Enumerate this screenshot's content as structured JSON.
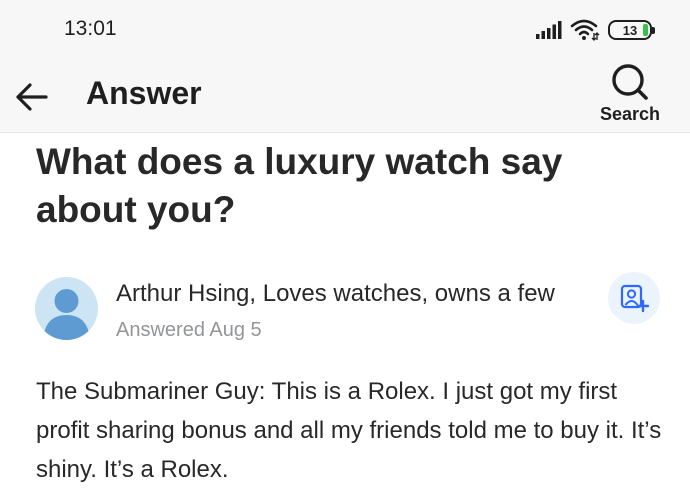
{
  "status_bar": {
    "time": "13:01",
    "battery": "13",
    "icons": [
      "signal-icon",
      "wifi-icon",
      "battery-icon"
    ]
  },
  "app_bar": {
    "title": "Answer",
    "back_icon": "arrow-left-icon",
    "search_label": "Search",
    "search_icon": "search-icon"
  },
  "question": {
    "title": "What does a luxury watch say about you?"
  },
  "answer": {
    "author": "Arthur Hsing, Loves watches, owns a few",
    "date": "Answered Aug 5",
    "follow_icon": "add-person-icon",
    "text": "The Submariner Guy: This is a Rolex. I just got my first profit sharing bonus and all my friends told me to buy it. It’s shiny. It’s a Rolex."
  },
  "colors": {
    "header_bg": "#f7f7f8",
    "text_primary": "#282829",
    "text_secondary": "#939598",
    "accent_blue": "#2e69ff",
    "follow_bg": "#ebf3fc",
    "battery_green": "#36c24a"
  }
}
